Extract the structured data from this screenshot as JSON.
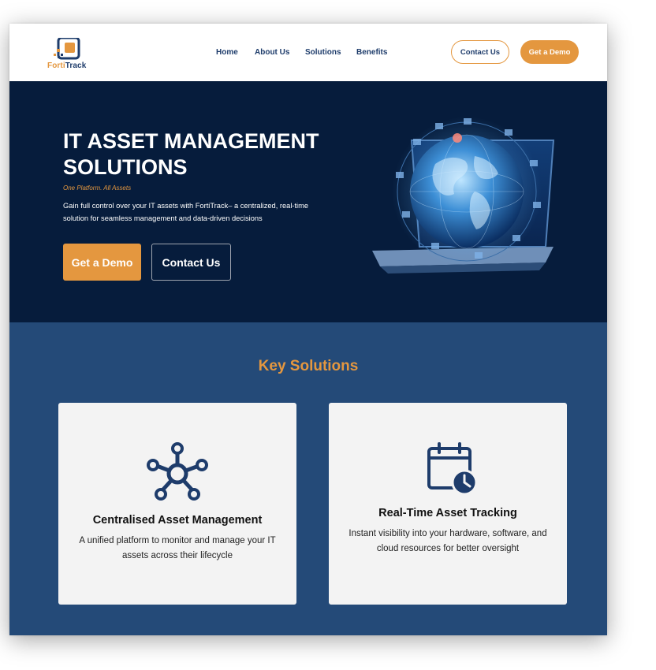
{
  "brand": {
    "name_part1": "Forti",
    "name_part2": "Track"
  },
  "nav": {
    "items": [
      "Home",
      "About Us",
      "Solutions",
      "Benefits"
    ],
    "contact_label": "Contact Us",
    "demo_label": "Get a Demo"
  },
  "hero": {
    "title": "IT ASSET MANAGEMENT SOLUTIONS",
    "tagline": "One Platform. All Assets",
    "description": "Gain full control over your IT assets with FortiTrack– a centralized, real-time solution for seamless management and data-driven decisions",
    "demo_label": "Get a Demo",
    "contact_label": "Contact Us",
    "image_icon": "globe-laptop-network"
  },
  "solutions": {
    "title": "Key Solutions",
    "cards": [
      {
        "icon": "network-hub-icon",
        "title": "Centralised Asset Management",
        "description": "A unified platform to monitor and manage your IT assets across their lifecycle"
      },
      {
        "icon": "calendar-clock-icon",
        "title": "Real-Time Asset Tracking",
        "description": "Instant visibility into your hardware, software, and cloud resources for better oversight"
      }
    ]
  },
  "colors": {
    "accent": "#e4973f",
    "navy": "#1e3c6b",
    "hero_bg": "#061c3c",
    "section_bg": "#244a78",
    "card_bg": "#f3f3f3"
  }
}
